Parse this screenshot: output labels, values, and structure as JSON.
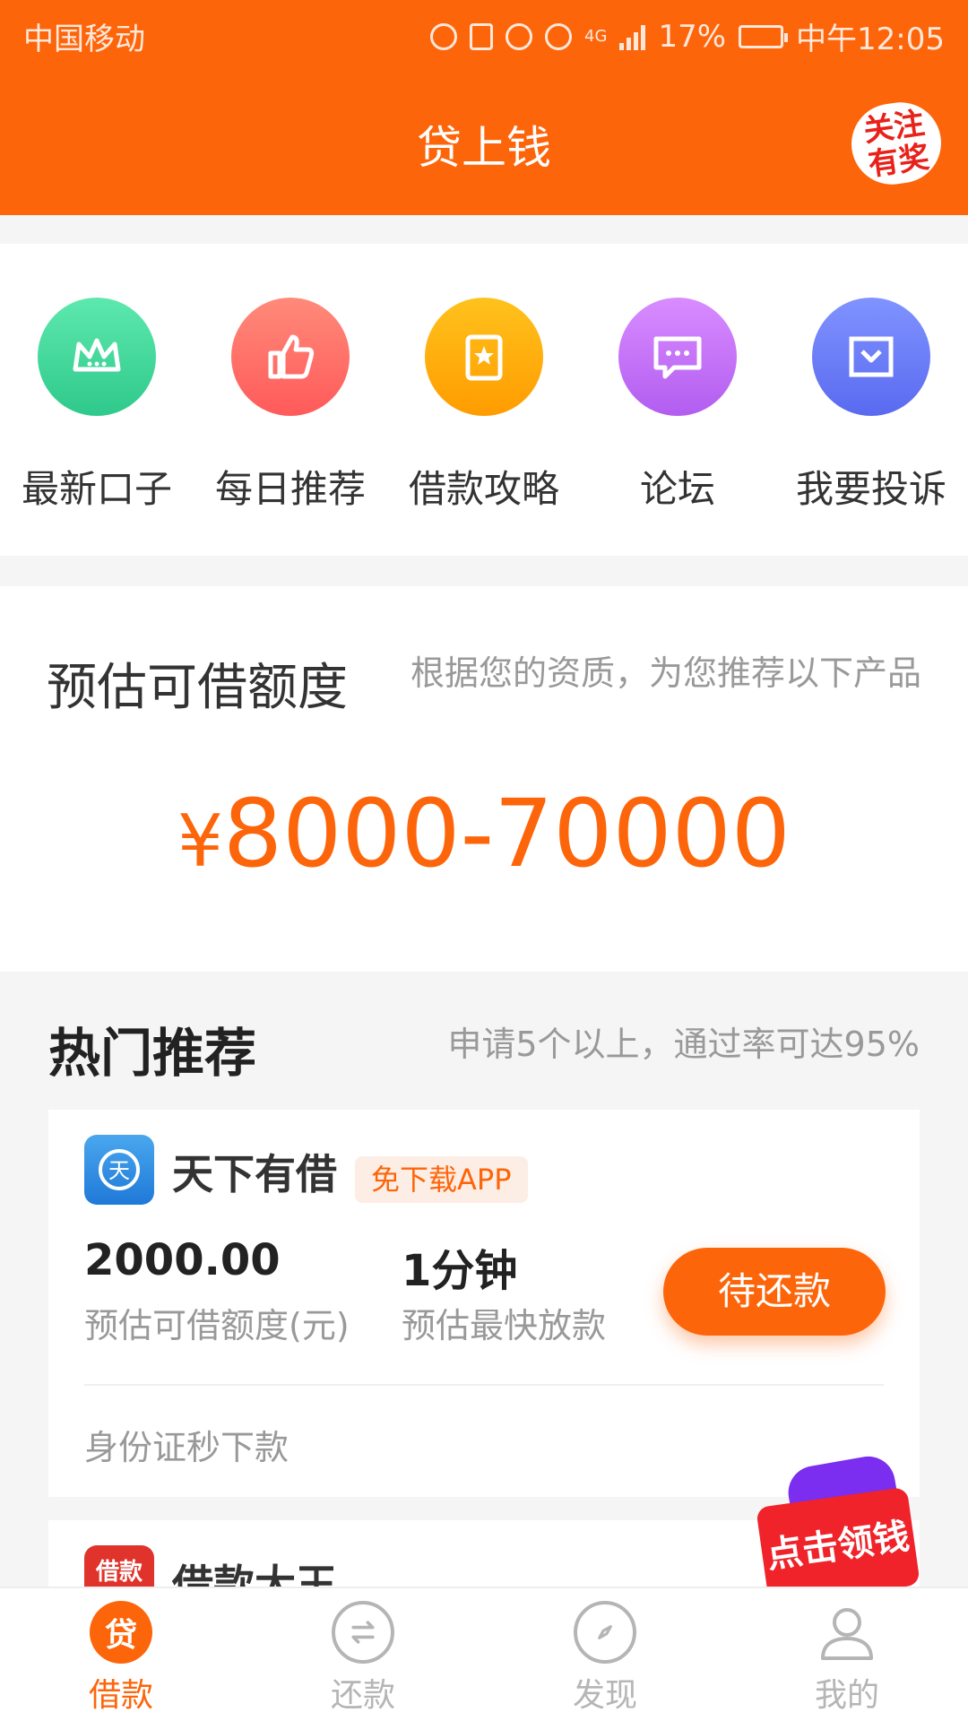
{
  "status_bar": {
    "carrier": "中国移动",
    "signal": "4G",
    "battery": "17%",
    "time": "中午12:05"
  },
  "header": {
    "title": "贷上钱",
    "promo_badge": [
      "关注",
      "有奖"
    ],
    "bg_color": "#fd650b"
  },
  "quick_menu": [
    {
      "label": "最新口子",
      "icon": "crown-icon",
      "color": "#3fd39a"
    },
    {
      "label": "每日推荐",
      "icon": "thumbs-up-icon",
      "color": "#ff6f6a"
    },
    {
      "label": "借款攻略",
      "icon": "bookmark-star-icon",
      "color": "#ffae10"
    },
    {
      "label": "论坛",
      "icon": "chat-bubble-icon",
      "color": "#c878f5"
    },
    {
      "label": "我要投诉",
      "icon": "mail-icon",
      "color": "#6a7ff5"
    }
  ],
  "estimate": {
    "title": "预估可借额度",
    "subtitle": "根据您的资质，为您推荐以下产品",
    "currency": "¥",
    "range": "8000-70000"
  },
  "hot": {
    "title": "热门推荐",
    "subtitle": "申请5个以上，通过率可达95%"
  },
  "products": [
    {
      "name": "天下有借",
      "logo_text": "天",
      "tag": "免下载APP",
      "amount": "2000.00",
      "amount_label": "预估可借额度(元)",
      "speed": "1分钟",
      "speed_label": "预估最快放款",
      "button": "待还款",
      "note": "身份证秒下款"
    },
    {
      "name": "借款大王",
      "logo_text": "借款"
    }
  ],
  "float_promo": {
    "label": "点击领钱"
  },
  "bottom_nav": [
    {
      "label": "借款",
      "icon_text": "贷",
      "active": true
    },
    {
      "label": "还款",
      "icon": "exchange-icon",
      "active": false
    },
    {
      "label": "发现",
      "icon": "compass-icon",
      "active": false
    },
    {
      "label": "我的",
      "icon": "user-icon",
      "active": false
    }
  ]
}
